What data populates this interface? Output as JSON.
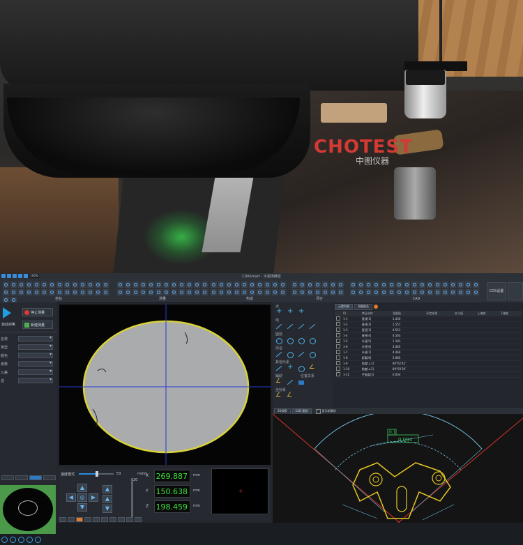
{
  "watermark": {
    "brand": "CHOTEST",
    "sub": "中图仪器"
  },
  "app": {
    "title": "CDASmart - 大视场精密",
    "quick_zoom": "100%",
    "ribbon_groups": [
      {
        "label": "坐标"
      },
      {
        "label": "测量"
      },
      {
        "label": "构造"
      },
      {
        "label": "评价"
      },
      {
        "label": "CAD"
      }
    ],
    "ribbon_big_button": "CDS设置"
  },
  "left": {
    "stop_button": "停止测量",
    "autofocus": "自动对焦",
    "new_button": "新建测量",
    "props": [
      {
        "label": "名称"
      },
      {
        "label": "类型"
      },
      {
        "label": "颜色"
      },
      {
        "label": "参数"
      },
      {
        "label": "公差"
      },
      {
        "label": "选"
      }
    ]
  },
  "controls": {
    "speed_label": "速度模式",
    "speed_value": "53",
    "speed_unit": "mm/s",
    "speed_fraction": 0.53,
    "z_value": "20",
    "x_axis": "X",
    "y_axis": "Y",
    "z_axis": "Z",
    "x": "269.887",
    "y": "150.638",
    "z": "198.459",
    "unit": "mm"
  },
  "tools": {
    "sections": [
      "点",
      "线",
      "圆弧",
      "拟合",
      "其他元素",
      "辅助",
      "位置关系",
      "坐标系"
    ]
  },
  "results": {
    "tabs": [
      "元素列表",
      "测量报告"
    ],
    "headers": [
      "ID",
      "特征名称",
      "测量值",
      "评定结果",
      "名义值",
      "上偏差",
      "下偏差"
    ],
    "rows": [
      [
        "1-1",
        "直线[1]",
        "1.430"
      ],
      [
        "1-2",
        "直径[2]",
        "1.557"
      ],
      [
        "1-3",
        "直径[3]",
        "4.551"
      ],
      [
        "1-4",
        "直径[4]",
        "4.563"
      ],
      [
        "1-5",
        "半径[5]",
        "1.183"
      ],
      [
        "1-6",
        "半径[6]",
        "3.465"
      ],
      [
        "1-7",
        "半径[7]",
        "4.460"
      ],
      [
        "1-8",
        "距离[8]",
        "3.985"
      ],
      [
        "1-9",
        "角度[∠1]",
        "90°02′42″"
      ],
      [
        "1-10",
        "角度[∠2]",
        "89°59′30″"
      ],
      [
        "1-11",
        "平面度[1]",
        "0.004"
      ]
    ]
  },
  "cad": {
    "tabs": [
      "2D视图",
      "CAD 图纸"
    ],
    "toggle_label": "显示轮廓线",
    "callout": "0.004",
    "callout_tag": "0.1"
  }
}
